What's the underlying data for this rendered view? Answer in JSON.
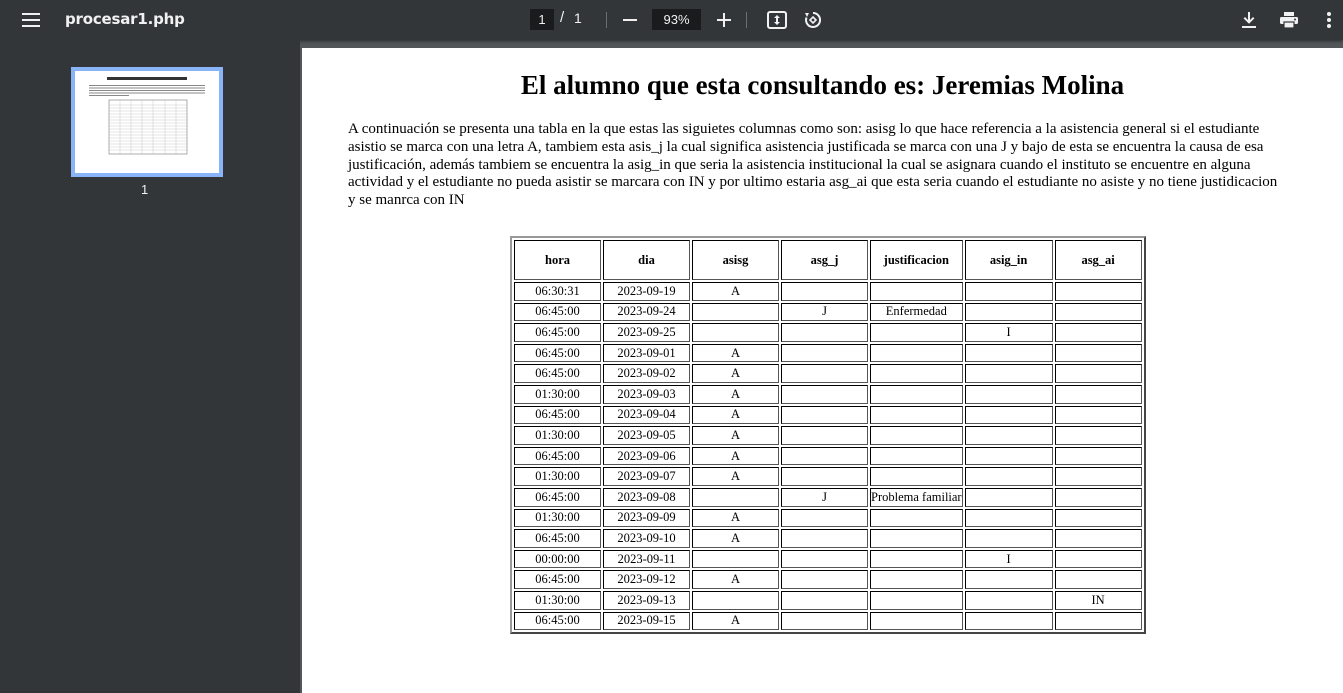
{
  "toolbar": {
    "file_title": "procesar1.php",
    "current_page": "1",
    "page_separator": "/",
    "total_pages": "1",
    "zoom": "93%"
  },
  "sidebar": {
    "thumbnail_label": "1"
  },
  "document": {
    "title": "El alumno que esta consultando es: Jeremias Molina",
    "paragraph": "A continuación se presenta una tabla en la que estas las siguietes columnas como son: asisg lo que hace referencia a la asistencia general si el estudiante asistio se marca con una letra A, tambiem esta asis_j la cual significa asistencia justificada se marca con una J y bajo de esta se encuentra la causa de esa justificación, además tambiem se encuentra la asig_in que seria la asistencia institucional la cual se asignara cuando el instituto se encuentre en alguna actividad y el estudiante no pueda asistir se marcara con IN y por ultimo estaria asg_ai que esta seria cuando el estudiante no asiste y no tiene justidicacion y se manrca con IN",
    "table": {
      "headers": [
        "hora",
        "dia",
        "asisg",
        "asg_j",
        "justificacion",
        "asig_in",
        "asg_ai"
      ],
      "rows": [
        [
          "06:30:31",
          "2023-09-19",
          "A",
          "",
          "",
          "",
          ""
        ],
        [
          "06:45:00",
          "2023-09-24",
          "",
          "J",
          "Enfermedad",
          "",
          ""
        ],
        [
          "06:45:00",
          "2023-09-25",
          "",
          "",
          "",
          "I",
          ""
        ],
        [
          "06:45:00",
          "2023-09-01",
          "A",
          "",
          "",
          "",
          ""
        ],
        [
          "06:45:00",
          "2023-09-02",
          "A",
          "",
          "",
          "",
          ""
        ],
        [
          "01:30:00",
          "2023-09-03",
          "A",
          "",
          "",
          "",
          ""
        ],
        [
          "06:45:00",
          "2023-09-04",
          "A",
          "",
          "",
          "",
          ""
        ],
        [
          "01:30:00",
          "2023-09-05",
          "A",
          "",
          "",
          "",
          ""
        ],
        [
          "06:45:00",
          "2023-09-06",
          "A",
          "",
          "",
          "",
          ""
        ],
        [
          "01:30:00",
          "2023-09-07",
          "A",
          "",
          "",
          "",
          ""
        ],
        [
          "06:45:00",
          "2023-09-08",
          "",
          "J",
          "Problema familiar",
          "",
          ""
        ],
        [
          "01:30:00",
          "2023-09-09",
          "A",
          "",
          "",
          "",
          ""
        ],
        [
          "06:45:00",
          "2023-09-10",
          "A",
          "",
          "",
          "",
          ""
        ],
        [
          "00:00:00",
          "2023-09-11",
          "",
          "",
          "",
          "I",
          ""
        ],
        [
          "06:45:00",
          "2023-09-12",
          "A",
          "",
          "",
          "",
          ""
        ],
        [
          "01:30:00",
          "2023-09-13",
          "",
          "",
          "",
          "",
          "IN"
        ],
        [
          "06:45:00",
          "2023-09-15",
          "A",
          "",
          "",
          "",
          ""
        ]
      ]
    }
  }
}
